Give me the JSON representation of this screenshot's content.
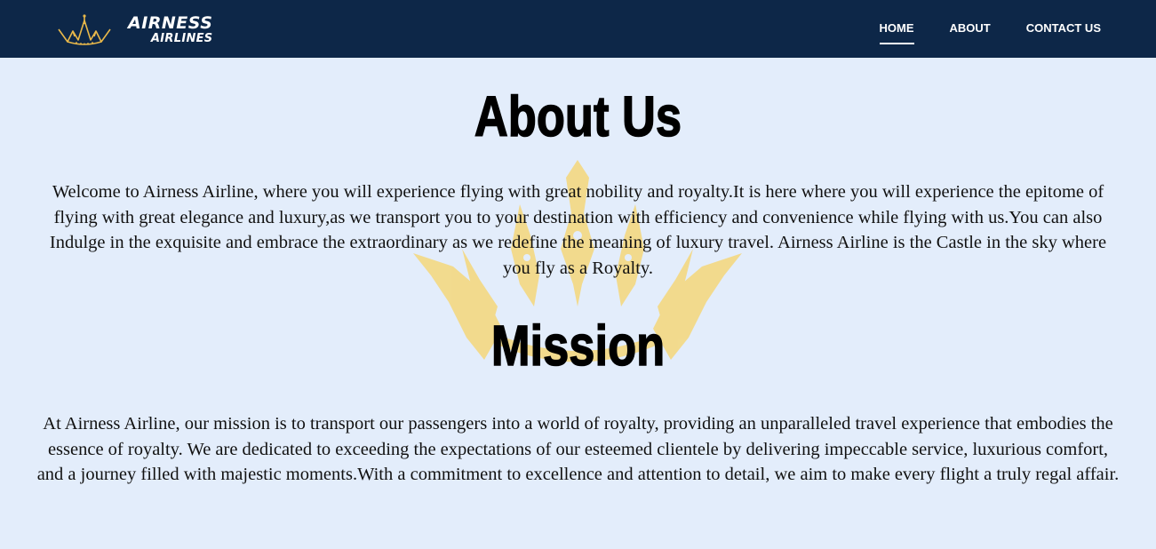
{
  "brand": {
    "name": "AIRNESS",
    "sub": "AIRLINES",
    "logo_icon": "crown-icon",
    "accent_color": "#e8b84a"
  },
  "nav": {
    "background": "#0d2748",
    "items": [
      {
        "label": "HOME",
        "active": true
      },
      {
        "label": "ABOUT",
        "active": false
      },
      {
        "label": "CONTACT US",
        "active": false
      }
    ]
  },
  "about": {
    "title": "About Us",
    "text": "Welcome to Airness Airline, where you will experience flying with great nobility and royalty.It is here where you will experience the epitome of flying with great elegance and luxury,as we transport you to your destination with efficiency and convenience while flying with us.You can also Indulge in the exquisite and embrace the extraordinary as we redefine the meaning of luxury travel. Airness Airline is the Castle in the sky where you fly as a Royalty."
  },
  "mission": {
    "title": "Mission",
    "text": "At Airness Airline, our mission is to transport our passengers into a world of royalty, providing an unparalleled travel experience that embodies the essence of royalty. We are dedicated to exceeding the expectations of our esteemed clientele by delivering impeccable service, luxurious comfort, and a journey filled with majestic moments.With a commitment to excellence and attention to detail, we aim to make every flight a truly regal affair."
  },
  "watermark_icon": "crown-watermark-icon",
  "page_background": "#e3edfb"
}
